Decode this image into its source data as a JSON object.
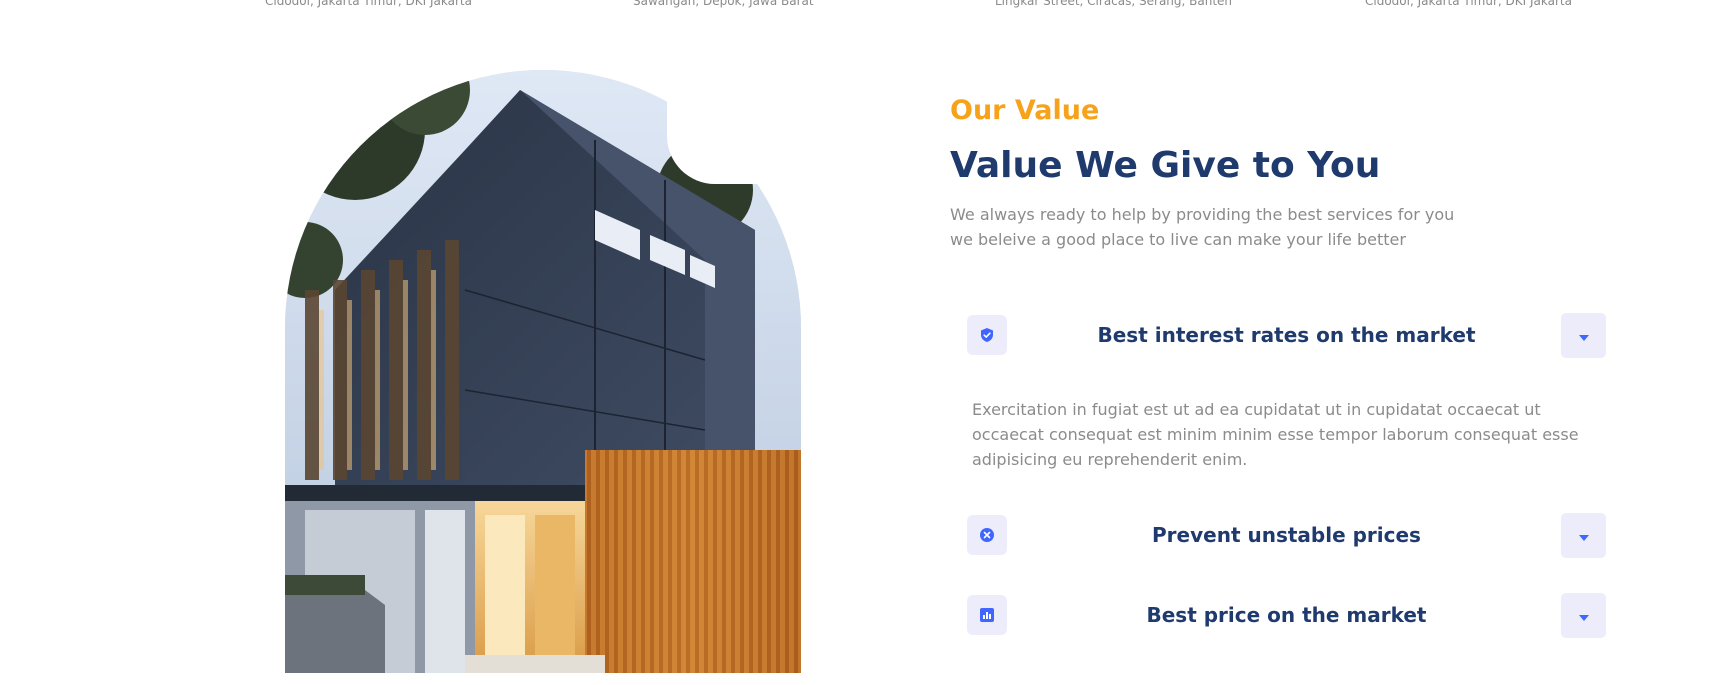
{
  "top_locations": [
    "Cidodol, Jakarta Timur, DKI Jakarta",
    "Sawangan, Depok, Jawa Barat",
    "Lingkar Street, Ciracas, Serang, Banten",
    "Cidodol, Jakarta Timur, DKI Jakarta"
  ],
  "image": {
    "alt": "Modern house exterior"
  },
  "section": {
    "eyebrow": "Our Value",
    "title": "Value We Give to You",
    "intro_lines": [
      "We always ready to help by providing the best services for you",
      "we beleive a good place to live can make your life better"
    ]
  },
  "accordion": {
    "items": [
      {
        "icon": "shield-check-icon",
        "title": "Best interest rates on the market",
        "expanded": true,
        "body_lines": [
          "Exercitation in fugiat est ut ad ea cupidatat ut in cupidatat occaecat ut",
          "occaecat consequat est minim minim esse tempor laborum consequat esse",
          "adipisicing eu reprehenderit enim."
        ]
      },
      {
        "icon": "x-circle-icon",
        "title": "Prevent unstable prices",
        "expanded": false
      },
      {
        "icon": "bar-chart-icon",
        "title": "Best price on the market",
        "expanded": false
      }
    ]
  },
  "colors": {
    "accent": "#f6a21b",
    "heading": "#1f3a6d",
    "body_text": "#8b8b8b",
    "icon_bg": "#ececfb",
    "icon_fg": "#4066ff"
  }
}
